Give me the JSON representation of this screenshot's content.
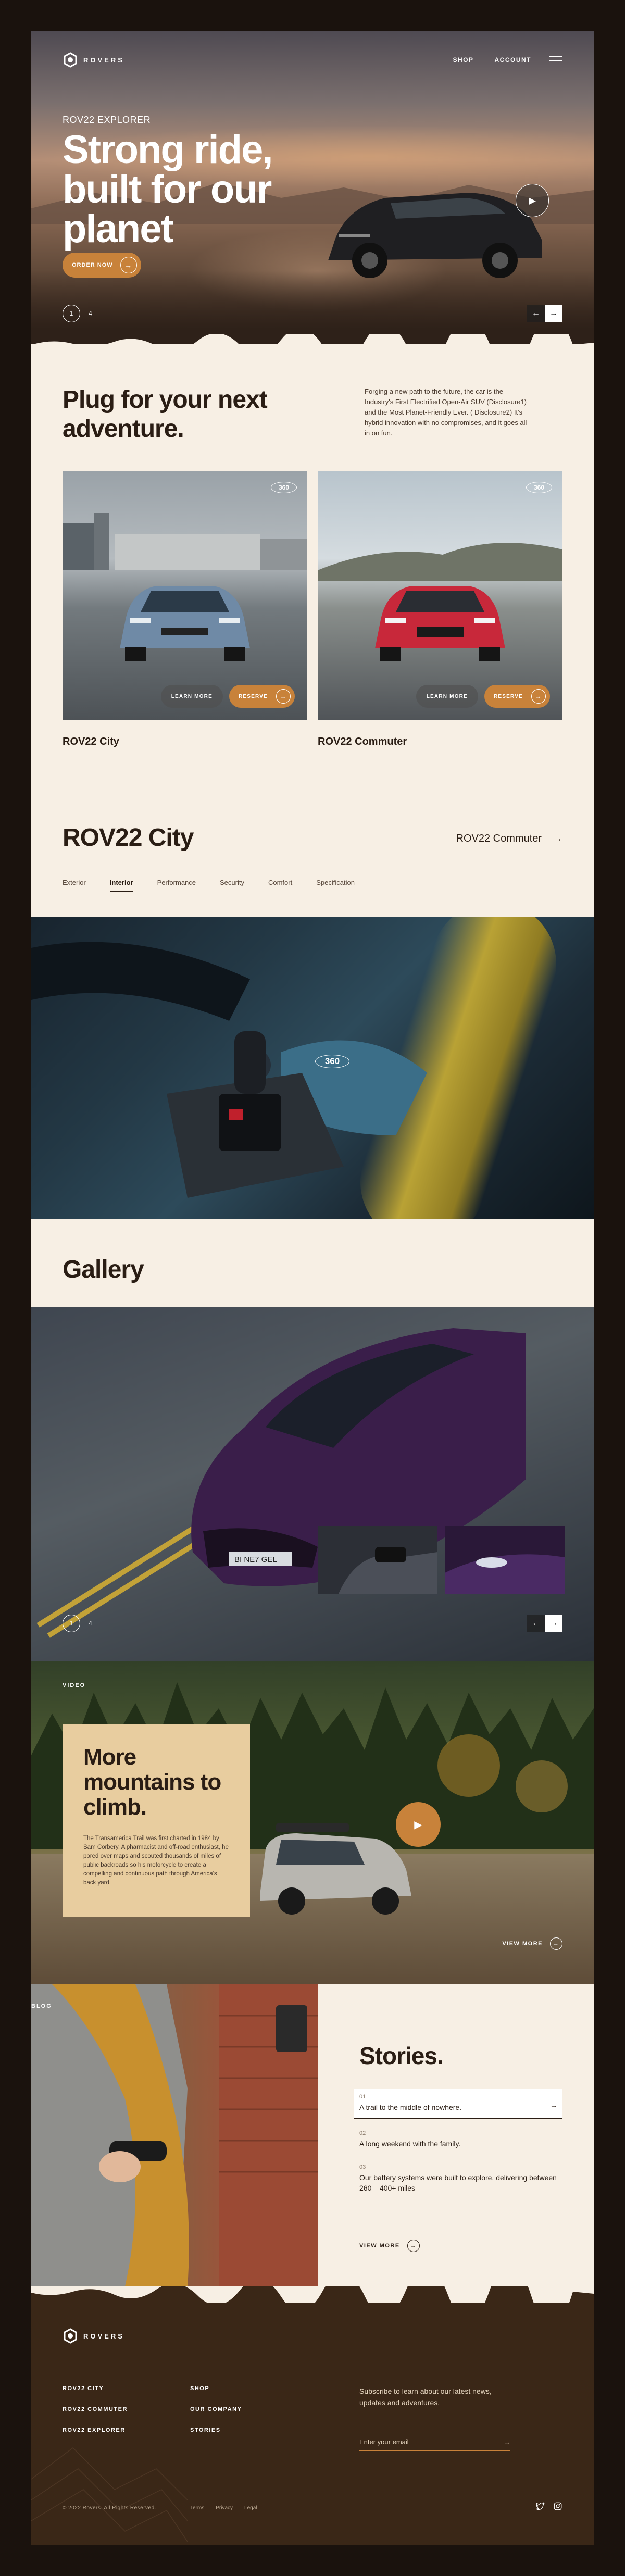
{
  "brand": {
    "name": "ROVERS",
    "accent": "#c8823a",
    "dark": "#1a120d",
    "cream": "#f7efe4"
  },
  "nav": {
    "shop": "SHOP",
    "account": "ACCOUNT"
  },
  "hero": {
    "eyebrow": "ROV22 EXPLORER",
    "title": "Strong ride, built for our planet",
    "order_label": "ORDER NOW",
    "index": "1",
    "total": "4"
  },
  "plug": {
    "title": "Plug for your next adventure.",
    "text": "Forging a new path to the future, the car is the Industry's First Electrified Open-Air SUV (Disclosure1) and the Most Planet-Friendly Ever. ( Disclosure2) It's hybrid innovation with no compromises, and it goes all in on fun.",
    "cards": [
      {
        "caption": "ROV22 City",
        "badge": "360",
        "learn": "LEARN MORE",
        "reserve": "RESERVE"
      },
      {
        "caption": "ROV22 Commuter",
        "badge": "360",
        "learn": "LEARN MORE",
        "reserve": "RESERVE"
      }
    ]
  },
  "model": {
    "title": "ROV22 City",
    "next": "ROV22 Commuter",
    "tabs": [
      "Exterior",
      "Interior",
      "Performance",
      "Security",
      "Comfort",
      "Specification"
    ],
    "active_tab": "Interior",
    "badge": "360"
  },
  "gallery": {
    "title": "Gallery",
    "plate": "BI NE7 GEL",
    "index": "1",
    "total": "4"
  },
  "video": {
    "label": "VIDEO",
    "title": "More mountains to climb.",
    "text": "The Transamerica Trail was first charted in 1984 by Sam Corbery. A pharmacist and off-road enthusiast, he pored over maps and scouted thousands of miles of public backroads so his motorcycle to create a compelling and continuous path through America's back yard.",
    "view_more": "VIEW MORE"
  },
  "stories": {
    "label": "BLOG",
    "title": "Stories.",
    "items": [
      {
        "num": "01",
        "text": "A trail to the middle of nowhere."
      },
      {
        "num": "02",
        "text": "A long weekend with the family."
      },
      {
        "num": "03",
        "text": "Our battery systems were built to explore, delivering between 260 – 400+ miles"
      }
    ],
    "view_more": "VIEW MORE"
  },
  "footer": {
    "links_col1": [
      "ROV22 CITY",
      "ROV22 COMMUTER",
      "ROV22 EXPLORER"
    ],
    "links_col2": [
      "SHOP",
      "OUR COMPANY",
      "STORIES"
    ],
    "subscribe": "Subscribe to learn about our latest news, updates and adventures.",
    "email_placeholder": "Enter your email",
    "copyright": "© 2022 Rovers. All Rights Reserved.",
    "legal": [
      "Terms",
      "Privacy",
      "Legal"
    ]
  }
}
